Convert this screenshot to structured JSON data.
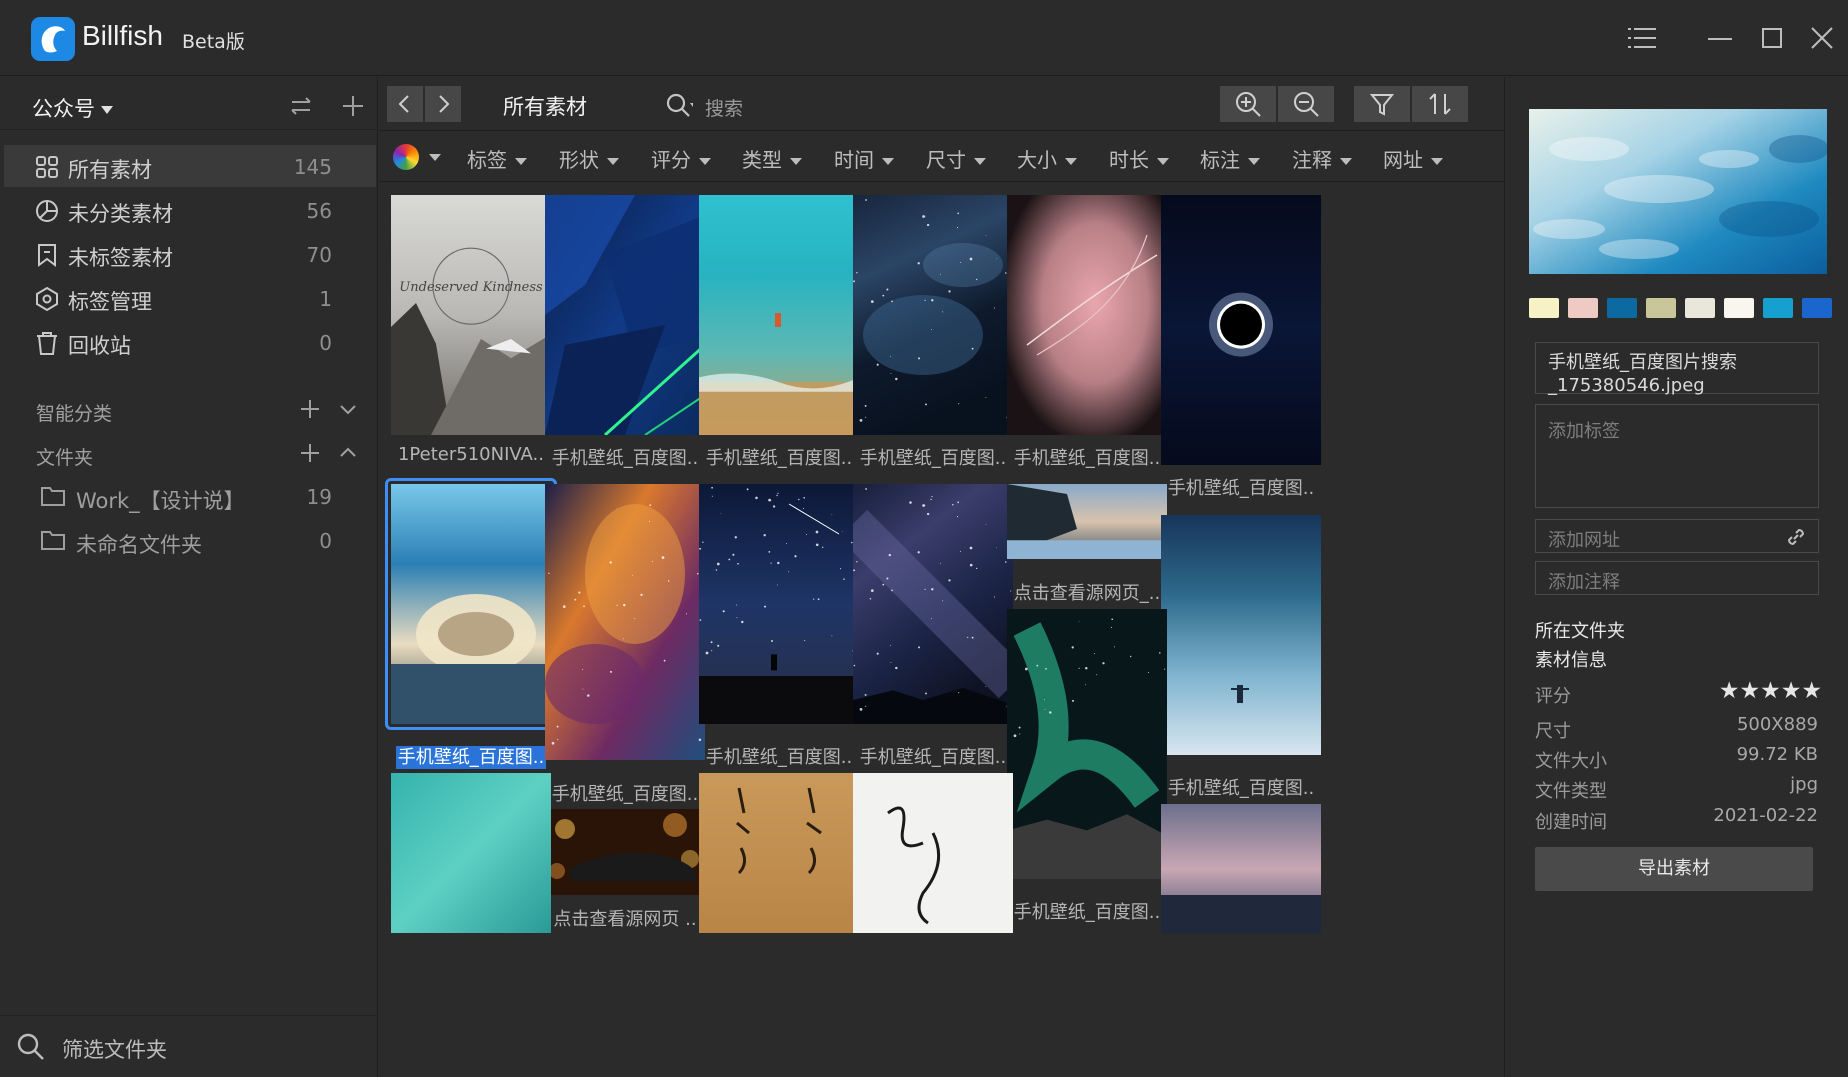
{
  "app": {
    "name": "Billfish",
    "badge": "Beta版"
  },
  "sidebar": {
    "library": "公众号",
    "nav": [
      {
        "label": "所有素材",
        "count": "145",
        "icon": "grid-icon"
      },
      {
        "label": "未分类素材",
        "count": "56",
        "icon": "pie-chart-icon"
      },
      {
        "label": "未标签素材",
        "count": "70",
        "icon": "bookmark-icon"
      },
      {
        "label": "标签管理",
        "count": "1",
        "icon": "tag-icon"
      },
      {
        "label": "回收站",
        "count": "0",
        "icon": "trash-icon"
      }
    ],
    "smart_section": "智能分类",
    "folder_section": "文件夹",
    "folders": [
      {
        "label": "Work_【设计说】",
        "count": "19"
      },
      {
        "label": "未命名文件夹",
        "count": "0"
      }
    ],
    "filter_folders": "筛选文件夹"
  },
  "toolbar": {
    "breadcrumb": "所有素材",
    "search_placeholder": "搜索"
  },
  "filters": [
    "标签",
    "形状",
    "评分",
    "类型",
    "时间",
    "尺寸",
    "大小",
    "时长",
    "标注",
    "注释",
    "网址"
  ],
  "assets": [
    {
      "caption": "1Peter510NIVA..",
      "colors": [
        "#d9d9d6",
        "#b9b8b5",
        "#6f6b66",
        "#3a3835"
      ],
      "art": "mountain-quote"
    },
    {
      "caption": "手机壁纸_百度图..",
      "colors": [
        "#0a1c44",
        "#113a86",
        "#0b2a5e",
        "#062017"
      ],
      "art": "abstract-blue"
    },
    {
      "caption": "手机壁纸_百度图..",
      "colors": [
        "#2fc1cf",
        "#27b3c0",
        "#5fb8b3",
        "#c79a5d"
      ],
      "art": "beach-aerial"
    },
    {
      "caption": "手机壁纸_百度图..",
      "colors": [
        "#17263d",
        "#2b4566",
        "#0e1a2c",
        "#08111e"
      ],
      "art": "nebula-dark"
    },
    {
      "caption": "手机壁纸_百度图..",
      "colors": [
        "#1a1214",
        "#b88086",
        "#e9a6ad",
        "#140e10"
      ],
      "art": "pink-curves"
    },
    {
      "caption": "手机壁纸_百度图..",
      "colors": [
        "#050a1c",
        "#0a1636",
        "#ffffff",
        "#000000"
      ],
      "art": "eclipse"
    },
    {
      "caption": "手机壁纸_百度图..",
      "colors": [
        "#79c8ea",
        "#2b7fb4",
        "#e9dcc0",
        "#2c3b4a"
      ],
      "art": "wave",
      "selected": true
    },
    {
      "caption": "手机壁纸_百度图..",
      "colors": [
        "#1b1f4a",
        "#d9792d",
        "#6d2a63",
        "#1f4f7d"
      ],
      "art": "galaxy-color"
    },
    {
      "caption": "手机壁纸_百度图..",
      "colors": [
        "#0d1838",
        "#1e3566",
        "#2a2e46",
        "#0b0b0e"
      ],
      "art": "starry-night"
    },
    {
      "caption": "手机壁纸_百度图..",
      "colors": [
        "#161f3b",
        "#3b3d6b",
        "#1c2548",
        "#0e1222"
      ],
      "art": "milky-way"
    },
    {
      "caption": "点击查看源网页_..",
      "colors": [
        "#88a9c9",
        "#d9c3ad",
        "#3f5466",
        "#1f2a33"
      ],
      "art": "ice-cliff"
    },
    {
      "caption": "手机壁纸_百度图..",
      "colors": [
        "#17355a",
        "#2d6a8c",
        "#7fb4cf",
        "#d8e6ef"
      ],
      "art": "misty-sea"
    },
    {
      "caption": "手机壁纸_百度图..",
      "colors": [
        "#07171a",
        "#18a38c",
        "#2fcf9f",
        "#3b3a3a"
      ],
      "art": "aurora"
    },
    {
      "caption": "点击查看源网页 ..",
      "colors": [
        "#2a1408",
        "#d98a33",
        "#1a1a1a",
        "#f0b84c"
      ],
      "art": "car-bokeh"
    },
    {
      "caption": "",
      "colors": [
        "#34b3ad",
        "#5ed0c3",
        "#2a9a97"
      ],
      "art": "teal"
    },
    {
      "caption": "",
      "colors": [
        "#c9995a",
        "#b98546",
        "#2a1d10"
      ],
      "art": "calligraphy"
    },
    {
      "caption": "",
      "colors": [
        "#f2f2f0",
        "#1a1a1a"
      ],
      "art": "ink"
    },
    {
      "caption": "",
      "colors": [
        "#6d6f8c",
        "#c9a7b4",
        "#384a67"
      ],
      "art": "dusk-city"
    }
  ],
  "detail": {
    "palette": [
      "#f7f2c6",
      "#efcac4",
      "#0d6aa0",
      "#c9c79a",
      "#e9e7d9",
      "#f8f6ef",
      "#15a0cf",
      "#1a66cc"
    ],
    "filename": "手机壁纸_百度图片搜索_175380546.jpeg",
    "tag_placeholder": "添加标签",
    "url_placeholder": "添加网址",
    "note_placeholder": "添加注释",
    "folder_heading": "所在文件夹",
    "info_heading": "素材信息",
    "rating_label": "评分",
    "rating": "★★★★★",
    "info": [
      {
        "label": "尺寸",
        "value": "500X889"
      },
      {
        "label": "文件大小",
        "value": "99.72 KB"
      },
      {
        "label": "文件类型",
        "value": "jpg"
      },
      {
        "label": "创建时间",
        "value": "2021-02-22"
      }
    ],
    "export_label": "导出素材"
  }
}
